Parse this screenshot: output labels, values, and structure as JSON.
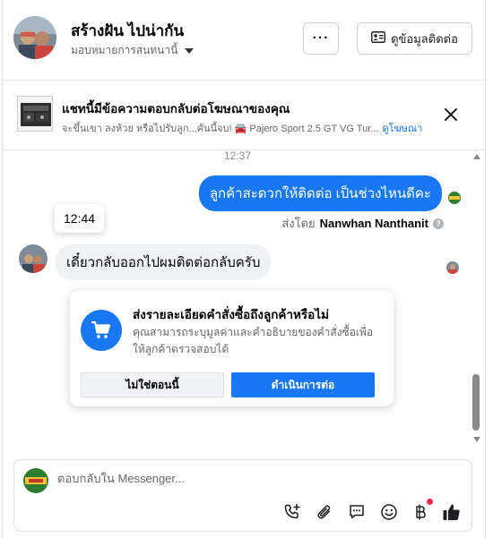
{
  "header": {
    "contact_name": "สร้างฝัน ไปน่ากัน",
    "assign_label": "มอบหมายการสนทนานี้",
    "more_label": "···",
    "contact_info_label": "ดูข้อมูลติดต่อ"
  },
  "ad_banner": {
    "title": "แชทนี้มีข้อความตอบกลับต่อโฆษณาของคุณ",
    "subtitle": "จะขึ้นเขา ลงห้วย หรือไปรับลูก...คันนี้จบ! 🚘 Pajero Sport 2.5 GT VG Tur...",
    "link_label": "ดูโฆษณา"
  },
  "messages": {
    "time_1": "12:37",
    "outgoing_text": "ลูกค้าสะดวกให้ติดต่อ เป็นช่วงไหนดีคะ",
    "sent_by_prefix": "ส่งโดย",
    "sent_by_name": "Nanwhan Nanthanit",
    "tooltip_time": "12:44",
    "incoming_text": "เดี๋ยวกลับออกไปผมติดต่อกลับครับ"
  },
  "order_card": {
    "title": "ส่งรายละเอียดคำสั่งซื้อถึงลูกค้าหรือไม่",
    "description": "คุณสามารถระบุมูลค่าและคำอธิบายของคำสั่งซื้อเพื่อให้ลูกค้าตรวจสอบได้",
    "secondary_label": "ไม่ใช่ตอนนี้",
    "primary_label": "ดำเนินการต่อ"
  },
  "composer": {
    "placeholder": "ตอบกลับใน Messenger..."
  },
  "colors": {
    "accent": "#1877f2",
    "bubble_in": "#f0f2f5",
    "notification": "#f02849"
  },
  "icons": [
    "chevron-down-icon",
    "contact-card-icon",
    "close-icon",
    "help-icon",
    "cart-icon",
    "add-call-icon",
    "attachment-icon",
    "saved-reply-icon",
    "emoji-icon",
    "baht-icon",
    "thumbs-up-icon"
  ]
}
